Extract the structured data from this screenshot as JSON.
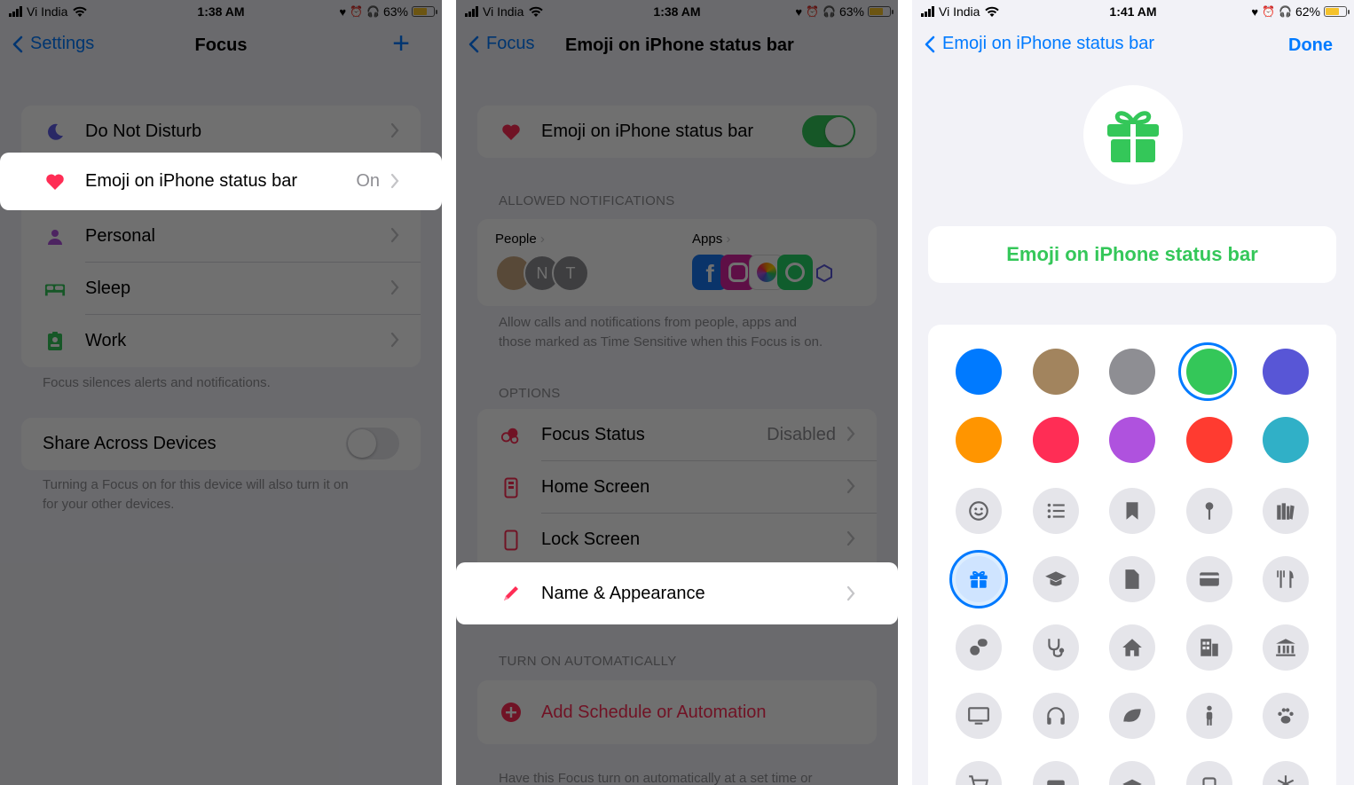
{
  "status": [
    {
      "carrier": "Vi India",
      "time": "1:38 AM",
      "battery": "63%",
      "battery_level": 0.63
    },
    {
      "carrier": "Vi India",
      "time": "1:38 AM",
      "battery": "63%",
      "battery_level": 0.63
    },
    {
      "carrier": "Vi India",
      "time": "1:41 AM",
      "battery": "62%",
      "battery_level": 0.62
    }
  ],
  "s1": {
    "back": "Settings",
    "title": "Focus",
    "rows": [
      {
        "label": "Do Not Disturb",
        "value": "",
        "icon": "moon-icon",
        "color": "#5e5ce6"
      },
      {
        "label": "Emoji on iPhone status bar",
        "value": "On",
        "icon": "heart-icon",
        "color": "#ff2d55"
      },
      {
        "label": "Personal",
        "value": "",
        "icon": "person-icon",
        "color": "#af52de"
      },
      {
        "label": "Sleep",
        "value": "",
        "icon": "bed-icon",
        "color": "#34c759"
      },
      {
        "label": "Work",
        "value": "",
        "icon": "badge-icon",
        "color": "#34c759"
      }
    ],
    "focus_footnote": "Focus silences alerts and notifications.",
    "share_label": "Share Across Devices",
    "share_on": false,
    "share_footnote_1": "Turning a Focus on for this device will also turn it on",
    "share_footnote_2": "for your other devices."
  },
  "s2": {
    "back": "Focus",
    "title": "Emoji on iPhone status bar",
    "focus_name": "Emoji on iPhone status bar",
    "focus_on": true,
    "allowed_header": "ALLOWED NOTIFICATIONS",
    "people_label": "People",
    "apps_label": "Apps",
    "avatars": [
      "N",
      "T"
    ],
    "allowed_note_1": "Allow calls and notifications from people, apps and",
    "allowed_note_2": "those marked as Time Sensitive when this Focus is on.",
    "options_header": "OPTIONS",
    "options": [
      {
        "label": "Focus Status",
        "value": "Disabled",
        "icon": "focus-status-icon"
      },
      {
        "label": "Home Screen",
        "value": "",
        "icon": "home-screen-icon"
      },
      {
        "label": "Lock Screen",
        "value": "",
        "icon": "lock-screen-icon"
      },
      {
        "label": "Name & Appearance",
        "value": "",
        "icon": "pencil-icon"
      }
    ],
    "auto_header": "TURN ON AUTOMATICALLY",
    "add_schedule": "Add Schedule or Automation",
    "auto_note": "Have this Focus turn on automatically at a set time or"
  },
  "s3": {
    "back": "Emoji on iPhone status bar",
    "done": "Done",
    "name_value": "Emoji on iPhone status bar",
    "accent": "#34c759",
    "colors": [
      "#007aff",
      "#a2845e",
      "#8e8e93",
      "#34c759",
      "#5856d6",
      "#ff9500",
      "#ff2d55",
      "#af52de",
      "#ff3b30",
      "#30b0c7"
    ],
    "selected_color_index": 3,
    "glyphs": [
      "smiley-icon",
      "list-icon",
      "bookmark-icon",
      "pin-icon",
      "books-icon",
      "gift-icon",
      "graduation-cap-icon",
      "document-icon",
      "credit-card-icon",
      "fork-knife-icon",
      "pills-icon",
      "stethoscope-icon",
      "house-icon",
      "building-icon",
      "bank-icon",
      "desktop-icon",
      "headphones-icon",
      "leaf-icon",
      "person-standing-icon",
      "paw-icon",
      "cart-icon",
      "briefcase-icon",
      "layers-icon",
      "cup-icon",
      "snowflake-icon"
    ],
    "selected_glyph_index": 5
  }
}
